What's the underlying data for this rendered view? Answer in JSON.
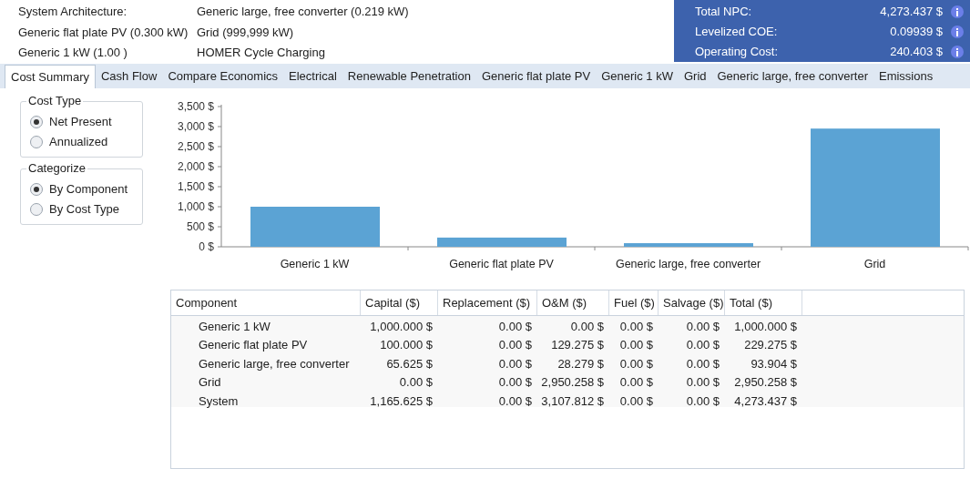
{
  "summary": {
    "rows": [
      [
        "System Architecture:",
        "Generic large, free converter (0.219 kW)"
      ],
      [
        "Generic flat plate PV (0.300 kW)",
        "Grid (999,999 kW)"
      ],
      [
        "Generic 1 kW (1.00 )",
        "HOMER Cycle Charging"
      ]
    ]
  },
  "metrics": [
    {
      "label": "Total NPC:",
      "value": "4,273.437 $"
    },
    {
      "label": "Levelized COE:",
      "value": "0.09939 $"
    },
    {
      "label": "Operating Cost:",
      "value": "240.403 $"
    }
  ],
  "tabs": [
    {
      "label": "Cost Summary",
      "selected": true
    },
    {
      "label": "Cash Flow",
      "selected": false
    },
    {
      "label": "Compare Economics",
      "selected": false
    },
    {
      "label": "Electrical",
      "selected": false
    },
    {
      "label": "Renewable Penetration",
      "selected": false
    },
    {
      "label": "Generic flat plate PV",
      "selected": false
    },
    {
      "label": "Generic 1 kW",
      "selected": false
    },
    {
      "label": "Grid",
      "selected": false
    },
    {
      "label": "Generic large, free converter",
      "selected": false
    },
    {
      "label": "Emissions",
      "selected": false
    }
  ],
  "option_groups": [
    {
      "title": "Cost Type",
      "options": [
        {
          "label": "Net Present",
          "selected": true
        },
        {
          "label": "Annualized",
          "selected": false
        }
      ]
    },
    {
      "title": "Categorize",
      "options": [
        {
          "label": "By Component",
          "selected": true
        },
        {
          "label": "By Cost Type",
          "selected": false
        }
      ]
    }
  ],
  "chart_data": {
    "type": "bar",
    "categories": [
      "Generic 1 kW",
      "Generic flat plate PV",
      "Generic large, free converter",
      "Grid"
    ],
    "series": [
      {
        "color": "#5ba3d4",
        "values": [
          1000,
          230,
          90,
          2950
        ]
      }
    ],
    "ylim": [
      0,
      3500
    ],
    "yticks": [
      {
        "value": 0,
        "label": "0 $"
      },
      {
        "value": 500,
        "label": "500 $"
      },
      {
        "value": 1000,
        "label": "1,000 $"
      },
      {
        "value": 1500,
        "label": "1,500 $"
      },
      {
        "value": 2000,
        "label": "2,000 $"
      },
      {
        "value": 2500,
        "label": "2,500 $"
      },
      {
        "value": 3000,
        "label": "3,000 $"
      },
      {
        "value": 3500,
        "label": "3,500 $"
      }
    ]
  },
  "table": {
    "columns": [
      "Component",
      "Capital ($)",
      "Replacement ($)",
      "O&M ($)",
      "Fuel ($)",
      "Salvage ($)",
      "Total ($)"
    ],
    "rows": [
      [
        "Generic 1 kW",
        "1,000.000 $",
        "0.00 $",
        "0.00 $",
        "0.00 $",
        "0.00 $",
        "1,000.000 $"
      ],
      [
        "Generic flat plate PV",
        "100.000 $",
        "0.00 $",
        "129.275 $",
        "0.00 $",
        "0.00 $",
        "229.275 $"
      ],
      [
        "Generic large, free converter",
        "65.625 $",
        "0.00 $",
        "28.279 $",
        "0.00 $",
        "0.00 $",
        "93.904 $"
      ],
      [
        "Grid",
        "0.00 $",
        "0.00 $",
        "2,950.258 $",
        "0.00 $",
        "0.00 $",
        "2,950.258 $"
      ],
      [
        "System",
        "1,165.625 $",
        "0.00 $",
        "3,107.812 $",
        "0.00 $",
        "0.00 $",
        "4,273.437 $"
      ]
    ]
  }
}
